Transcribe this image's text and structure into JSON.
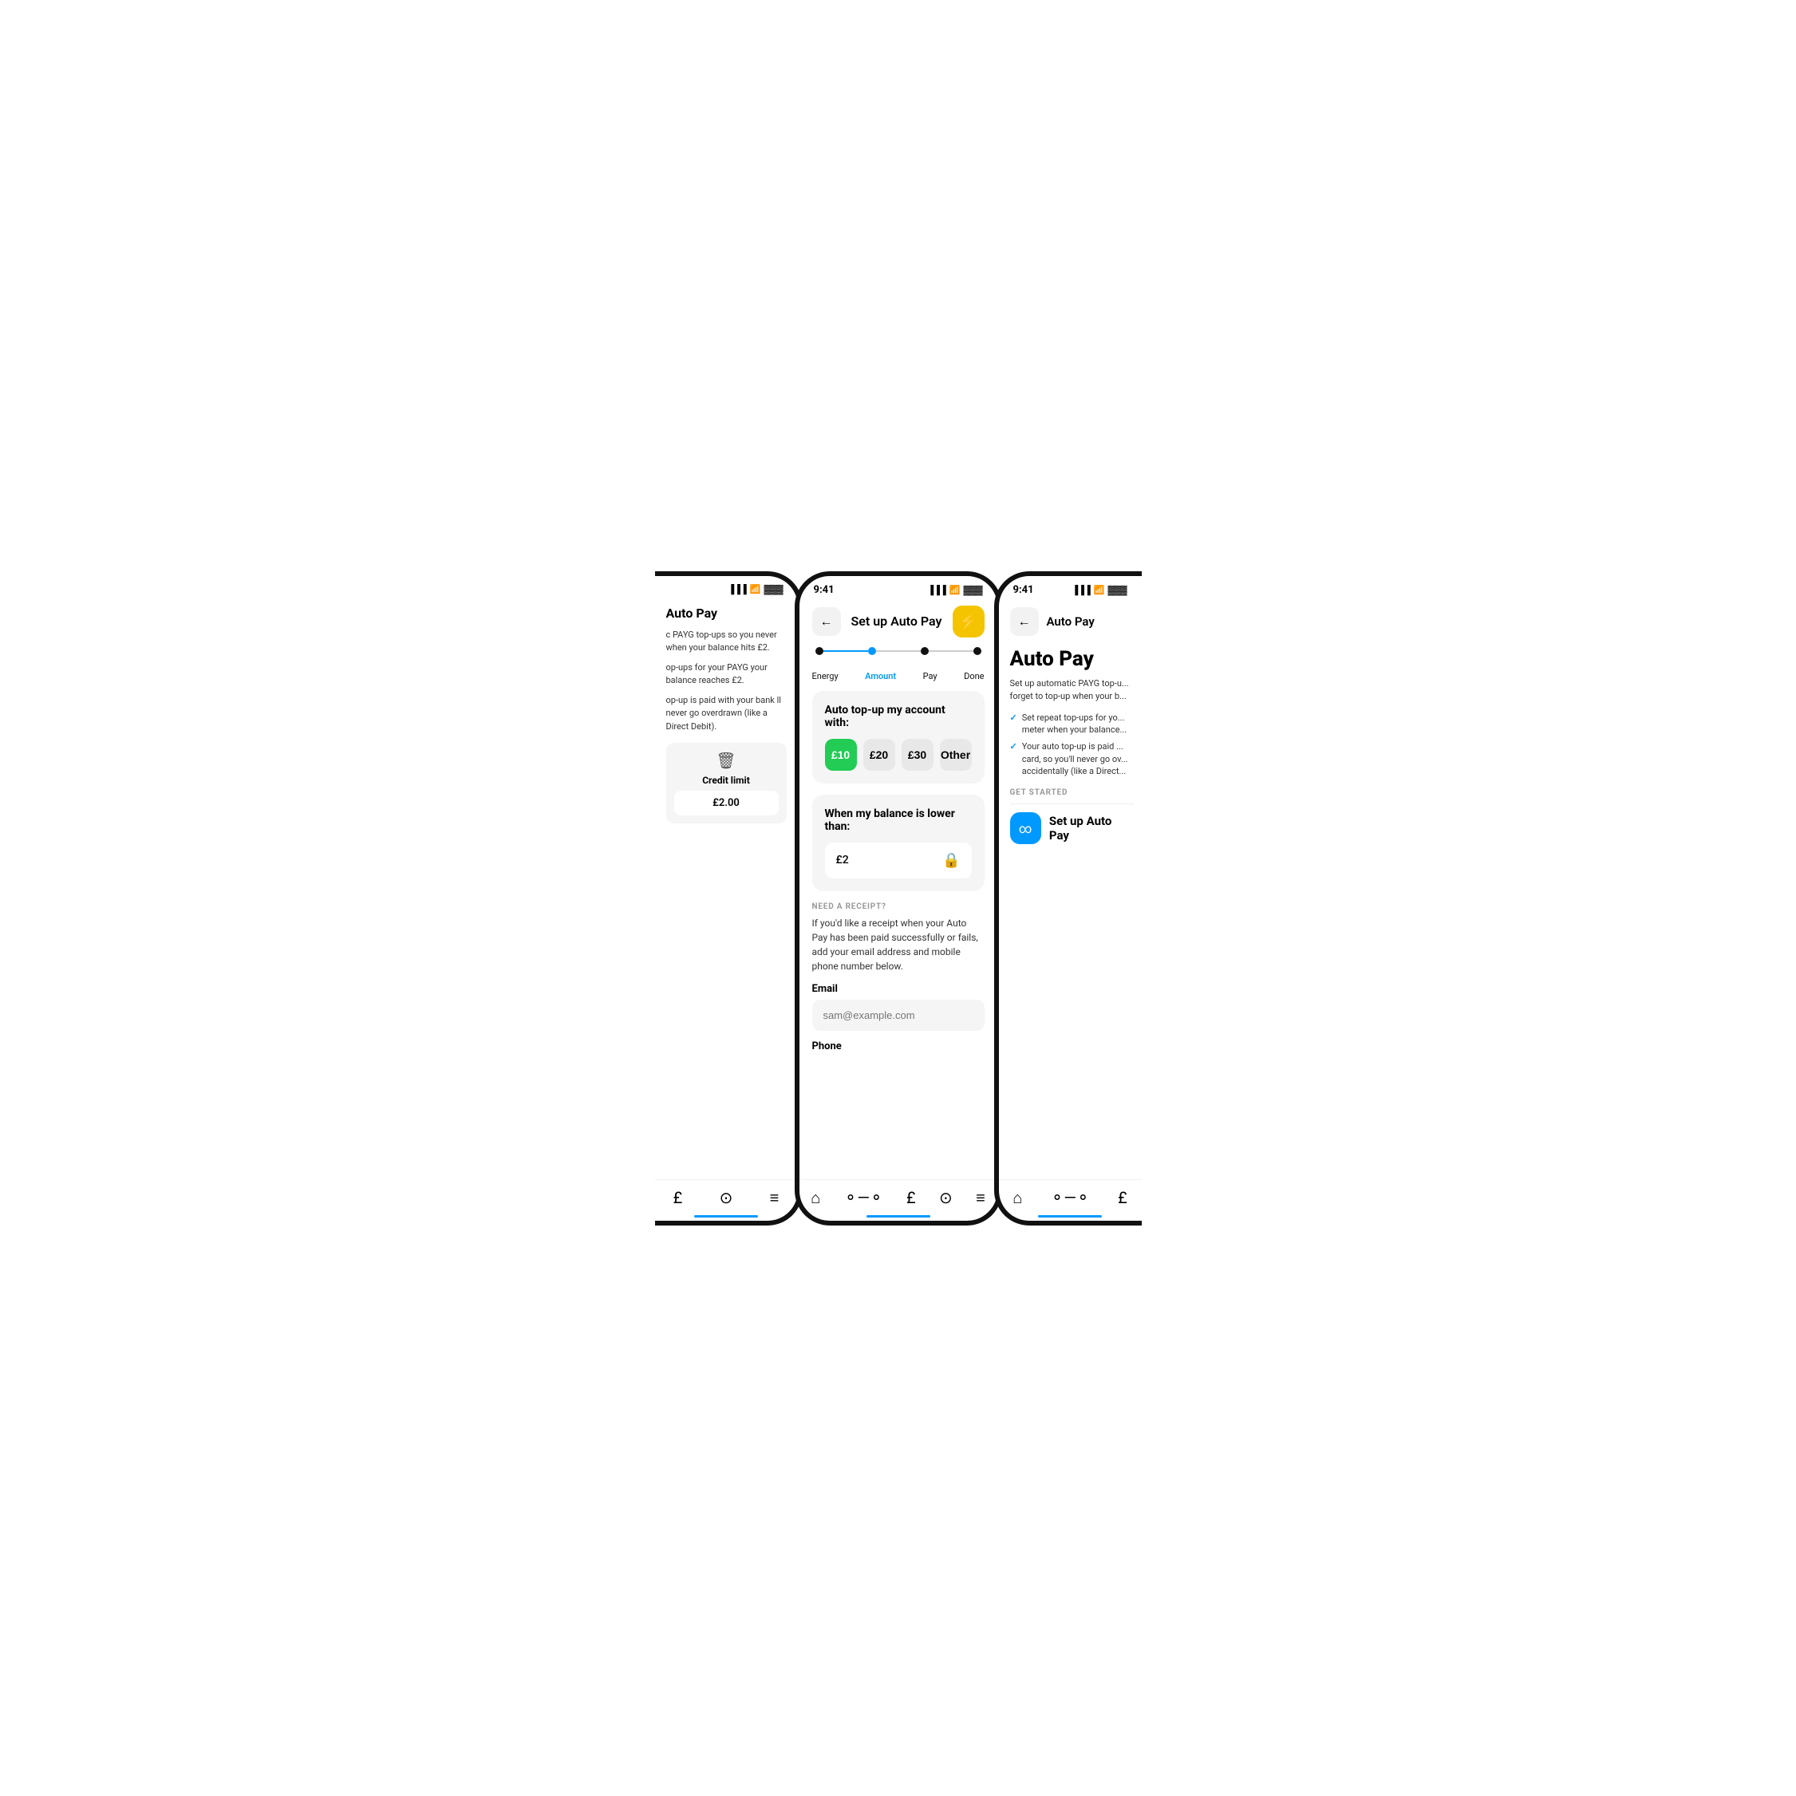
{
  "left_phone": {
    "title": "Auto Pay",
    "text1": "c PAYG top-ups so you never when your balance hits £2.",
    "text2": "op-ups for your PAYG your balance reaches £2.",
    "text3": "op-up is paid with your bank ll never go overdrawn (like a Direct Debit).",
    "credit_label": "Credit limit",
    "credit_value": "£2.00",
    "nav": {
      "tab1": "£",
      "tab2": "?",
      "tab3": "≡"
    }
  },
  "center_phone": {
    "status_time": "9:41",
    "nav_title": "Set up Auto Pay",
    "back_icon": "←",
    "lightning_icon": "⚡",
    "steps": [
      "Energy",
      "Amount",
      "Pay",
      "Done"
    ],
    "active_step": 1,
    "auto_topup_label": "Auto top-up my account with:",
    "amount_options": [
      "£10",
      "£20",
      "£30",
      "Other"
    ],
    "selected_amount": 0,
    "balance_label": "When my balance is lower than:",
    "balance_value": "£2",
    "receipt_section_label": "NEED A RECEIPT?",
    "receipt_text": "If you'd like a receipt when your Auto Pay has been paid successfully or fails, add your email address and mobile phone number below.",
    "email_label": "Email",
    "email_placeholder": "sam@example.com",
    "phone_label": "Phone",
    "nav_tabs": [
      "🏠",
      "⟡",
      "£",
      "?",
      "≡"
    ]
  },
  "right_phone": {
    "status_time": "9:41",
    "back_icon": "←",
    "page_title": "Auto Pay",
    "main_title": "Auto Pay",
    "main_text": "Set up automatic PAYG top-u... forget to top-up when your b...",
    "check_items": [
      "Set repeat top-ups for yo... meter when your balance...",
      "Your auto top-up is paid ... card, so you'll never go ov... accidentally (like a Direct..."
    ],
    "get_started_label": "GET STARTED",
    "setup_button_label": "Set up Auto Pay",
    "nav_tabs": [
      "🏠",
      "⟡",
      "£"
    ]
  },
  "colors": {
    "accent_blue": "#0099ff",
    "accent_green": "#22cc55",
    "accent_yellow": "#f5c400",
    "bg_gray": "#f5f5f5",
    "text_dark": "#111111",
    "text_muted": "#999999"
  }
}
